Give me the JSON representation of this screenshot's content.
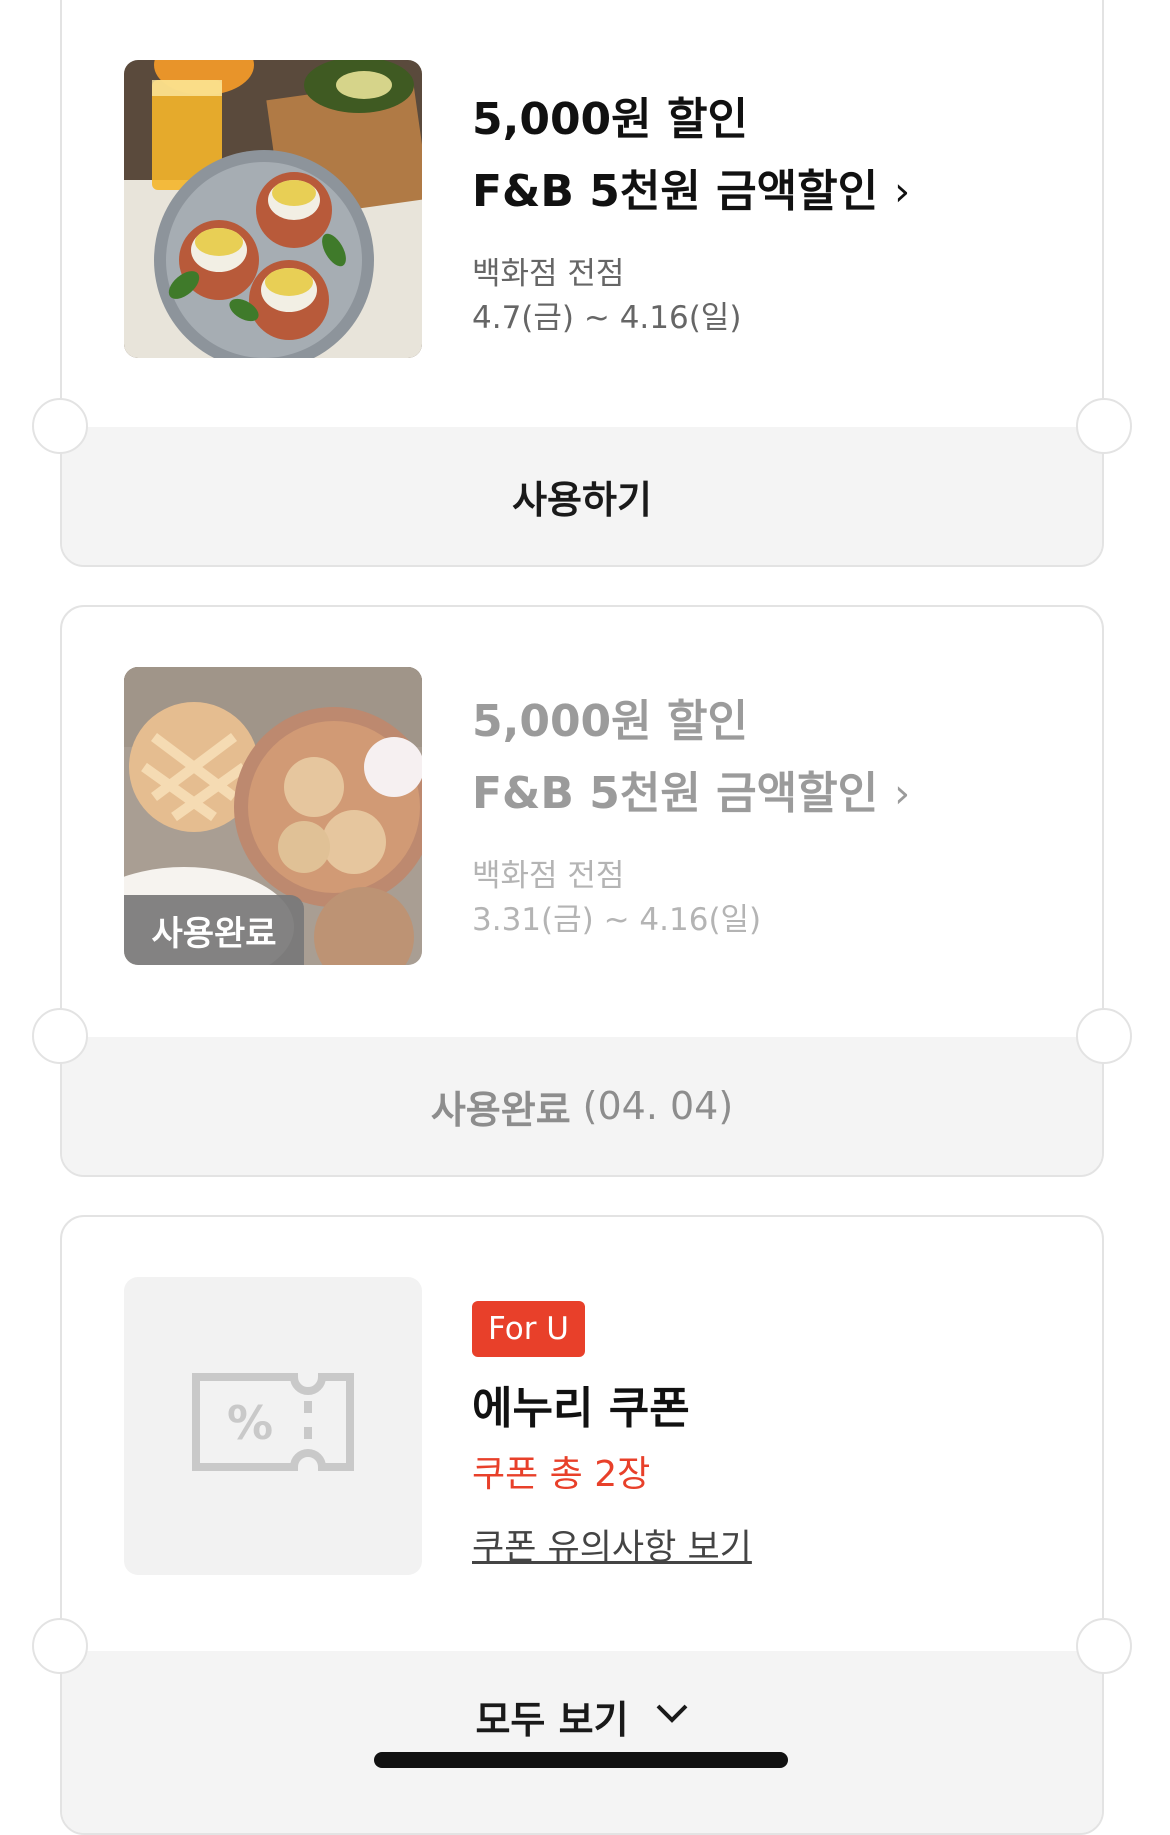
{
  "coupons": [
    {
      "discount": "5,000원 할인",
      "name": "F&B 5천원 금액할인",
      "chevron": "›",
      "location": "백화점 전점",
      "period": "4.7(금) ~ 4.16(일)",
      "action_label": "사용하기",
      "image": "eggs-benedict-photo"
    },
    {
      "discount": "5,000원 할인",
      "name": "F&B 5천원 금액할인",
      "chevron": "›",
      "location": "백화점 전점",
      "period": "3.31(금) ~ 4.16(일)",
      "badge": "사용완료",
      "status_label": "사용완료",
      "status_date": "(04. 04)",
      "image": "pie-and-crackers-photo"
    },
    {
      "tag": "For U",
      "title": "에누리 쿠폰",
      "count_text": "쿠폰 총 2장",
      "notice_link": "쿠폰 유의사항 보기",
      "see_all_label": "모두 보기",
      "image": "coupon-ticket-icon"
    }
  ],
  "colors": {
    "accent": "#e8402a",
    "card_border": "#e3e3e3",
    "footer_bg": "#f4f4f4"
  }
}
